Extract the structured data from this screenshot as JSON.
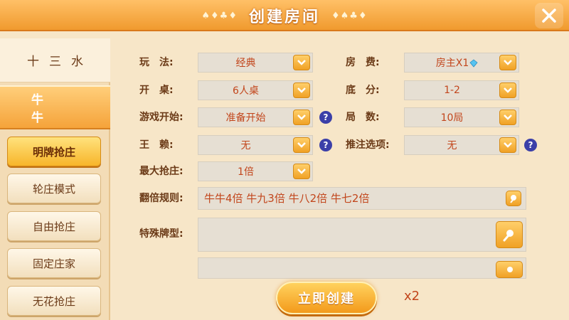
{
  "header": {
    "title": "创建房间",
    "suits_left": "♠♦♣♦",
    "suits_right": "♦♠♣♦"
  },
  "sidebar": {
    "categories": [
      {
        "label": "十三水"
      },
      {
        "label": "牛牛"
      }
    ],
    "modes": [
      {
        "label": "明牌抢庄"
      },
      {
        "label": "轮庄模式"
      },
      {
        "label": "自由抢庄"
      },
      {
        "label": "固定庄家"
      },
      {
        "label": "无花抢庄"
      }
    ]
  },
  "settings": {
    "play": {
      "label": "玩　法:",
      "value": "经典"
    },
    "fee": {
      "label": "房　费:",
      "value": "房主X1"
    },
    "table": {
      "label": "开　桌:",
      "value": "6人桌"
    },
    "base": {
      "label": "底　分:",
      "value": "1-2"
    },
    "start": {
      "label": "游戏开始:",
      "value": "准备开始"
    },
    "rounds": {
      "label": "局　数:",
      "value": "10局"
    },
    "wild": {
      "label": "王　赖:",
      "value": "无"
    },
    "push": {
      "label": "推注选项:",
      "value": "无"
    },
    "maxbid": {
      "label": "最大抢庄:",
      "value": "1倍"
    },
    "multiplier": {
      "label": "翻倍规则:",
      "value": "牛牛4倍 牛九3倍 牛八2倍 牛七2倍"
    },
    "special": {
      "label": "特殊牌型:",
      "value": ""
    }
  },
  "footer": {
    "create_label": "立即创建",
    "cost": "x2"
  },
  "icons": {
    "help": "?"
  },
  "colors": {
    "accent": "#f5a33a",
    "value_text": "#c2461c",
    "label_text": "#6b3a17"
  }
}
